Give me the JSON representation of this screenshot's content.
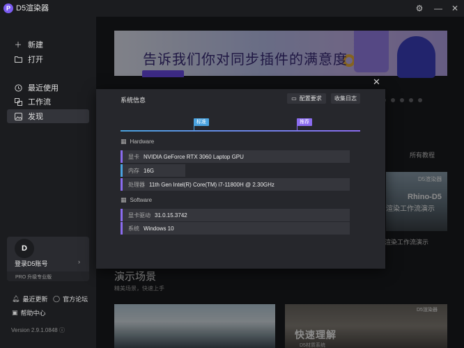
{
  "app": {
    "logo_letter": "P",
    "name": "D5渲染器"
  },
  "sidebar": {
    "items": [
      {
        "label": "新建",
        "icon": "plus-icon"
      },
      {
        "label": "打开",
        "icon": "folder-icon"
      },
      {
        "label": "最近使用",
        "icon": "clock-icon"
      },
      {
        "label": "工作流",
        "icon": "workflow-icon"
      },
      {
        "label": "发现",
        "icon": "image-icon"
      }
    ],
    "login": {
      "avatar_letter": "D",
      "label": "登录D5账号",
      "arrow": "›",
      "pro_text": "PRO  升级专业版"
    },
    "links": {
      "updates": "最近更新",
      "forum": "官方论坛",
      "help": "帮助中心"
    },
    "version": "Version 2.9.1.0848"
  },
  "main": {
    "banner_text": "告诉我们你对同步插件的满意度",
    "all_tutorials": "所有教程",
    "card_right": {
      "logo": "D5渲染器",
      "title1": "Rhino-D5",
      "title2": "渲染工作流演示",
      "caption": "渲染工作流演示"
    },
    "demo": {
      "title": "演示场景",
      "subtitle": "精美场景，快速上手"
    },
    "scene2": {
      "title": "快速理解",
      "subtitle": "D5材质系统",
      "logo": "D5渲染器"
    }
  },
  "modal": {
    "title": "系统信息",
    "btn_requirements": "配置要求",
    "btn_log": "收集日志",
    "marker_standard": "标准",
    "marker_recommended": "推荐",
    "hardware": {
      "heading": "Hardware",
      "rows": [
        {
          "key": "显卡",
          "value": "NVIDIA GeForce RTX 3060 Laptop GPU"
        },
        {
          "key": "内存",
          "value": "16G"
        },
        {
          "key": "处理器",
          "value": "11th Gen Intel(R) Core(TM) i7-11800H @ 2.30GHz"
        }
      ]
    },
    "software": {
      "heading": "Software",
      "rows": [
        {
          "key": "显卡驱动",
          "value": "31.0.15.3742"
        },
        {
          "key": "系统",
          "value": "Windows 10"
        }
      ]
    }
  },
  "colors": {
    "accent": "#8b6cf0",
    "blue": "#4aa3e0",
    "background": "#1b1c1f",
    "modal": "#26272c"
  }
}
